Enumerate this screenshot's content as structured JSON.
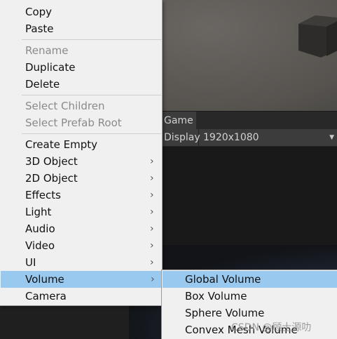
{
  "editor": {
    "game_tab_label": "Game",
    "display_label": "Display 1",
    "resolution_label": "1920x1080"
  },
  "context_menu": {
    "groups": [
      [
        {
          "label": "Copy",
          "enabled": true
        },
        {
          "label": "Paste",
          "enabled": true
        }
      ],
      [
        {
          "label": "Rename",
          "enabled": false
        },
        {
          "label": "Duplicate",
          "enabled": true
        },
        {
          "label": "Delete",
          "enabled": true
        }
      ],
      [
        {
          "label": "Select Children",
          "enabled": false
        },
        {
          "label": "Select Prefab Root",
          "enabled": false
        }
      ],
      [
        {
          "label": "Create Empty",
          "enabled": true
        },
        {
          "label": "3D Object",
          "enabled": true,
          "submenu": true
        },
        {
          "label": "2D Object",
          "enabled": true,
          "submenu": true
        },
        {
          "label": "Effects",
          "enabled": true,
          "submenu": true
        },
        {
          "label": "Light",
          "enabled": true,
          "submenu": true
        },
        {
          "label": "Audio",
          "enabled": true,
          "submenu": true
        },
        {
          "label": "Video",
          "enabled": true,
          "submenu": true
        },
        {
          "label": "UI",
          "enabled": true,
          "submenu": true
        },
        {
          "label": "Volume",
          "enabled": true,
          "submenu": true,
          "highlighted": true
        },
        {
          "label": "Camera",
          "enabled": true
        }
      ]
    ]
  },
  "volume_submenu": {
    "items": [
      {
        "label": "Global Volume",
        "highlighted": true
      },
      {
        "label": "Box Volume"
      },
      {
        "label": "Sphere Volume"
      },
      {
        "label": "Convex Mesh Volume"
      }
    ]
  },
  "watermark": "CSDN @顾士源叻",
  "colors": {
    "menu_bg": "#f0f0f0",
    "highlight": "#99c9ef",
    "disabled_text": "#8a8a8a"
  }
}
